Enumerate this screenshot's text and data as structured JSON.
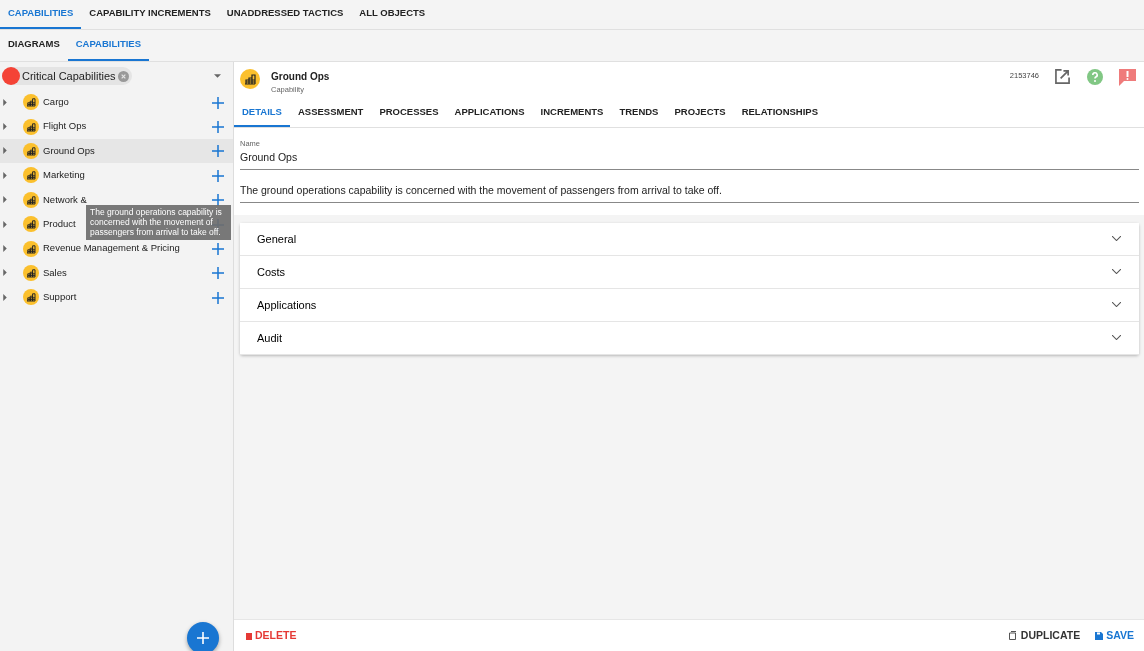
{
  "top_tabs": [
    {
      "label": "CAPABILITIES",
      "selected": true
    },
    {
      "label": "CAPABILITY INCREMENTS",
      "selected": false
    },
    {
      "label": "UNADDRESSED TACTICS",
      "selected": false
    },
    {
      "label": "ALL OBJECTS",
      "selected": false
    }
  ],
  "sub_tabs": [
    {
      "label": "DIAGRAMS",
      "selected": false
    },
    {
      "label": "CAPABILITIES",
      "selected": true
    }
  ],
  "filter": {
    "label": "Critical Capabilities",
    "color": "#f44336"
  },
  "tree": [
    {
      "label": "Cargo",
      "selected": false
    },
    {
      "label": "Flight Ops",
      "selected": false
    },
    {
      "label": "Ground Ops",
      "selected": true
    },
    {
      "label": "Marketing",
      "selected": false
    },
    {
      "label": "Network &",
      "selected": false
    },
    {
      "label": "Product",
      "selected": false
    },
    {
      "label": "Revenue Management & Pricing",
      "selected": false
    },
    {
      "label": "Sales",
      "selected": false
    },
    {
      "label": "Support",
      "selected": false
    }
  ],
  "tooltip": "The ground operations capability is concerned with the movement of passengers from arrival to take off.",
  "header": {
    "title": "Ground Ops",
    "subtitle": "Capability",
    "id": "2153746"
  },
  "detail_tabs": [
    {
      "label": "DETAILS",
      "selected": true
    },
    {
      "label": "ASSESSMENT",
      "selected": false
    },
    {
      "label": "PROCESSES",
      "selected": false
    },
    {
      "label": "APPLICATIONS",
      "selected": false
    },
    {
      "label": "INCREMENTS",
      "selected": false
    },
    {
      "label": "TRENDS",
      "selected": false
    },
    {
      "label": "PROJECTS",
      "selected": false
    },
    {
      "label": "RELATIONSHIPS",
      "selected": false
    }
  ],
  "fields": [
    {
      "label": "Name",
      "value": "Ground Ops"
    },
    {
      "value": "The ground operations capability is concerned with the movement of passengers from arrival to take off."
    }
  ],
  "sections": [
    {
      "label": "General",
      "expanded": false
    },
    {
      "label": "Costs",
      "expanded": false
    },
    {
      "label": "Applications",
      "expanded": false
    },
    {
      "label": "Audit",
      "expanded": false
    }
  ],
  "footer": {
    "delete": "DELETE",
    "duplicate": "DUPLICATE",
    "save": "SAVE"
  }
}
